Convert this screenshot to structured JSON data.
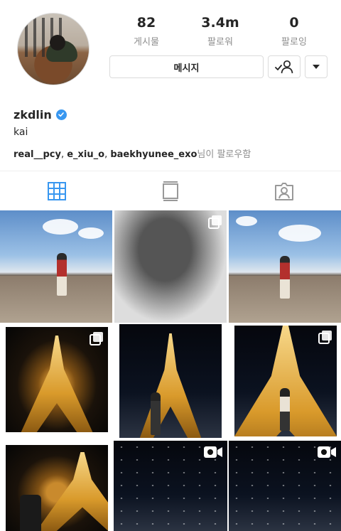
{
  "profile": {
    "username": "zkdlin",
    "full_name": "kai",
    "verified": true
  },
  "stats": [
    {
      "value": "82",
      "label": "게시물"
    },
    {
      "value": "3.4m",
      "label": "팔로워"
    },
    {
      "value": "0",
      "label": "팔로잉"
    }
  ],
  "actions": {
    "message_label": "메시지",
    "follow_icon": "following-person-icon",
    "more_icon": "caret-down-icon"
  },
  "followed_by": {
    "users": [
      "real__pcy",
      "e_xiu_o",
      "baekhyunee_exo"
    ],
    "separator": ", ",
    "suffix": "님이 팔로우함"
  },
  "tabs": [
    {
      "icon": "grid-icon",
      "active": true
    },
    {
      "icon": "feed-icon",
      "active": false
    },
    {
      "icon": "tagged-icon",
      "active": false
    }
  ],
  "posts": [
    {
      "scene": "field-sky",
      "badge": null
    },
    {
      "scene": "bw-tree",
      "badge": "multiple-photos-icon"
    },
    {
      "scene": "field-sky-2",
      "badge": null
    },
    {
      "scene": "eiffel-night",
      "badge": "multiple-photos-icon"
    },
    {
      "scene": "eiffel-night-person",
      "badge": null
    },
    {
      "scene": "eiffel-under",
      "badge": "multiple-photos-icon"
    },
    {
      "scene": "eiffel-closeup",
      "badge": null
    },
    {
      "scene": "night-crowd",
      "badge": "video-icon"
    },
    {
      "scene": "night-crowd-2",
      "badge": "video-icon"
    }
  ],
  "colors": {
    "verified_blue": "#3897f0",
    "tab_active": "#3897f0",
    "tab_inactive": "#999999"
  }
}
